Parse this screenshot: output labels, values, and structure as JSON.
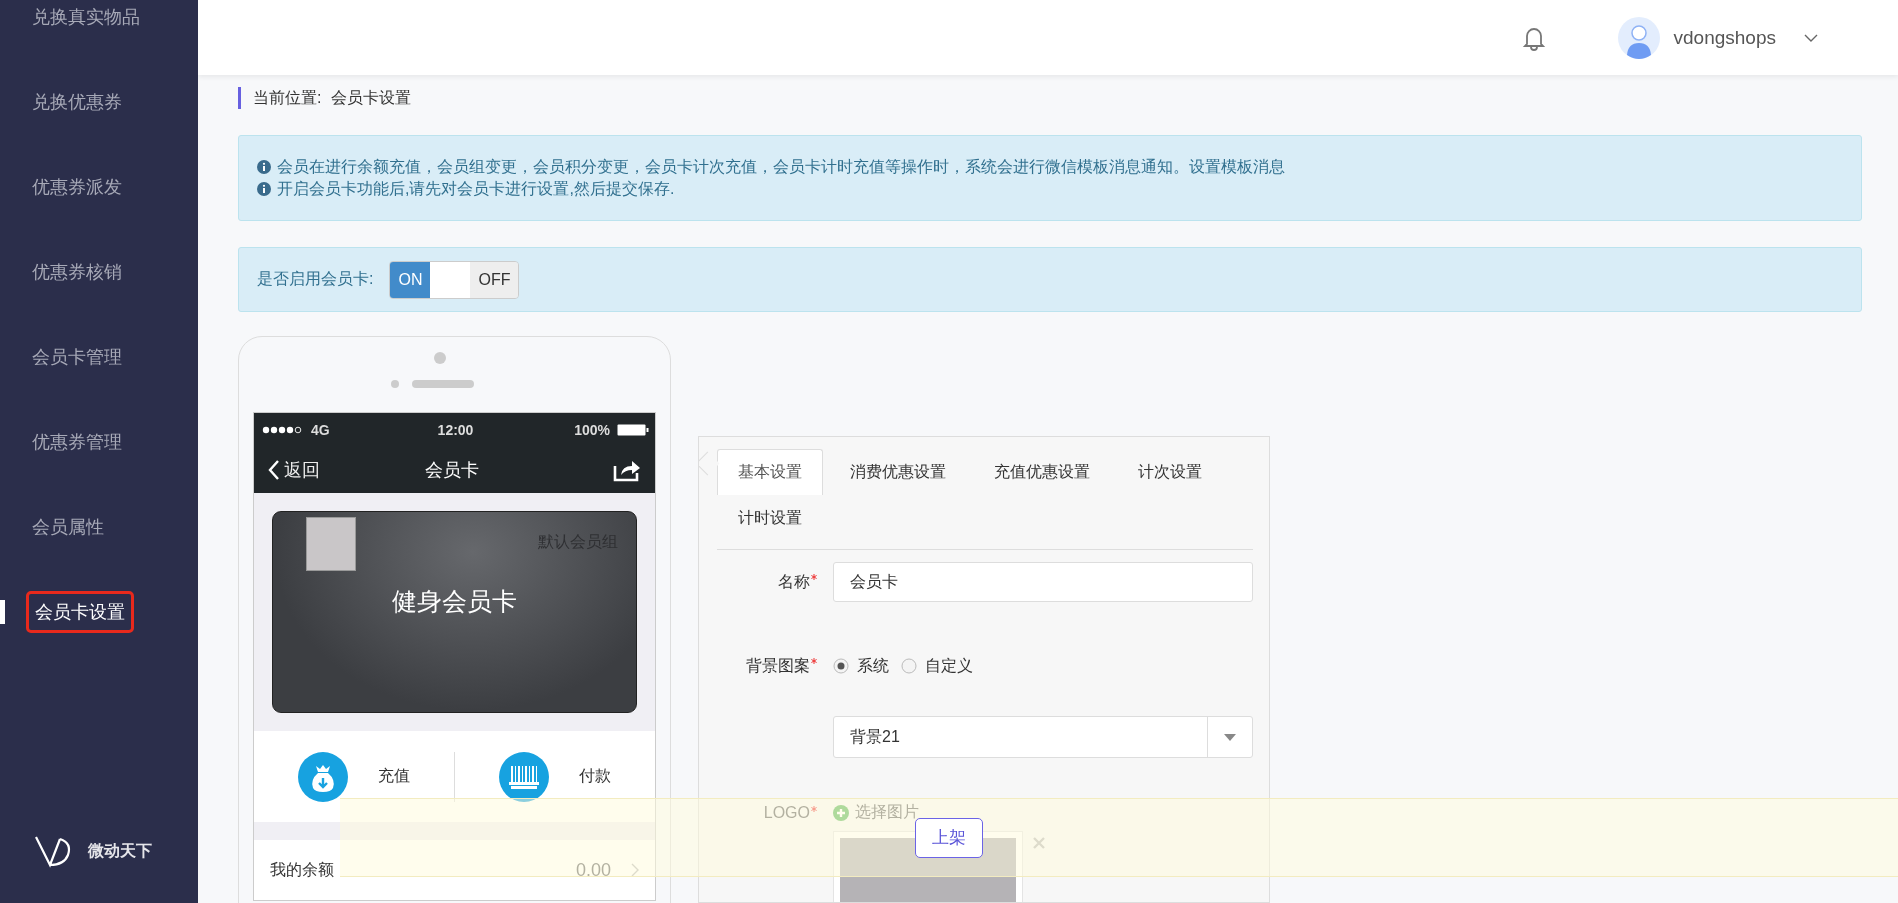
{
  "sidebar": {
    "items": [
      {
        "label": "兑换真实物品",
        "selected": false
      },
      {
        "label": "兑换优惠券",
        "selected": false
      },
      {
        "label": "优惠券派发",
        "selected": false
      },
      {
        "label": "优惠券核销",
        "selected": false
      },
      {
        "label": "会员卡管理",
        "selected": false
      },
      {
        "label": "优惠券管理",
        "selected": false
      },
      {
        "label": "会员属性",
        "selected": false
      },
      {
        "label": "会员卡设置",
        "selected": true
      }
    ],
    "brand": "微动天下"
  },
  "header": {
    "user": "vdongshops"
  },
  "breadcrumb": {
    "label": "当前位置:",
    "current": "会员卡设置"
  },
  "notices": [
    "会员在进行余额充值，会员组变更，会员积分变更，会员卡计次充值，会员卡计时充值等操作时，系统会进行微信模板消息通知。设置模板消息",
    "开启会员卡功能后,请先对会员卡进行设置,然后提交保存."
  ],
  "enable": {
    "label": "是否启用会员卡:",
    "on_label": "ON",
    "off_label": "OFF",
    "on": true
  },
  "phone": {
    "status": {
      "carrier": "4G",
      "time": "12:00",
      "battery": "100%"
    },
    "nav": {
      "back": "返回",
      "title": "会员卡"
    },
    "card": {
      "group": "默认会员组",
      "name": "健身会员卡"
    },
    "actions": [
      {
        "kind": "recharge",
        "label": "充值"
      },
      {
        "kind": "pay",
        "label": "付款"
      }
    ],
    "balance": {
      "label": "我的余额",
      "value": "0.00"
    }
  },
  "settings": {
    "tabs": [
      {
        "label": "基本设置",
        "selected": true
      },
      {
        "label": "消费优惠设置",
        "selected": false
      },
      {
        "label": "充值优惠设置",
        "selected": false
      },
      {
        "label": "计次设置",
        "selected": false
      },
      {
        "label": "计时设置",
        "selected": false
      }
    ],
    "name": {
      "label": "名称",
      "required": true,
      "value": "会员卡"
    },
    "background": {
      "label": "背景图案",
      "required": true,
      "options": [
        {
          "label": "系统",
          "selected": true
        },
        {
          "label": "自定义",
          "selected": false
        }
      ],
      "select": "背景21"
    },
    "logo": {
      "label": "LOGO",
      "required": true,
      "choose": "选择图片"
    }
  },
  "footer": {
    "button": "上架"
  }
}
